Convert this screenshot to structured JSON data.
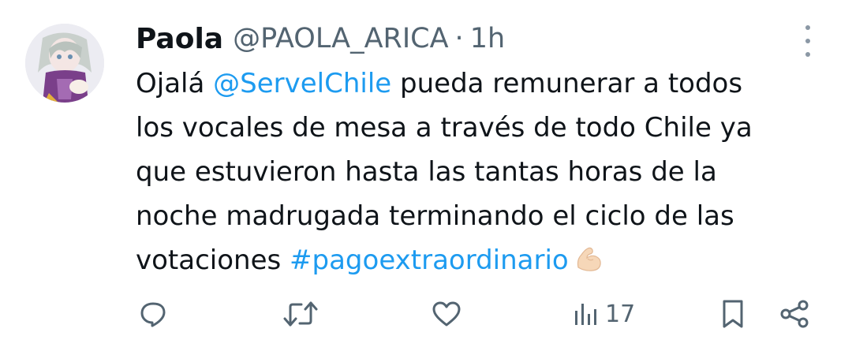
{
  "tweet": {
    "author": {
      "display_name": "Paola",
      "handle": "@PAOLA_ARICA",
      "separator": "·",
      "time": "1h"
    },
    "text": {
      "line1": {
        "before": "Ojalá ",
        "mention": "@ServelChile",
        "after": " pueda remunerar a todos"
      },
      "line2": "los vocales de mesa a través de todo Chile ya",
      "line3": "que estuvieron hasta las tantas horas de la",
      "line4": "noche madrugada terminando el ciclo de las",
      "line5": {
        "before": "votaciones ",
        "hashtag": "#pagoextraordinario",
        "emoji": "flexed-biceps-emoji"
      }
    },
    "actions": {
      "reply_icon": "reply-icon",
      "retweet_icon": "retweet-icon",
      "like_icon": "like-icon",
      "views_icon": "views-icon",
      "views_count": "17",
      "bookmark_icon": "bookmark-icon",
      "share_icon": "share-icon"
    },
    "colors": {
      "link": "#1d9bf0",
      "text": "#0f1419",
      "muted": "#536471"
    }
  }
}
